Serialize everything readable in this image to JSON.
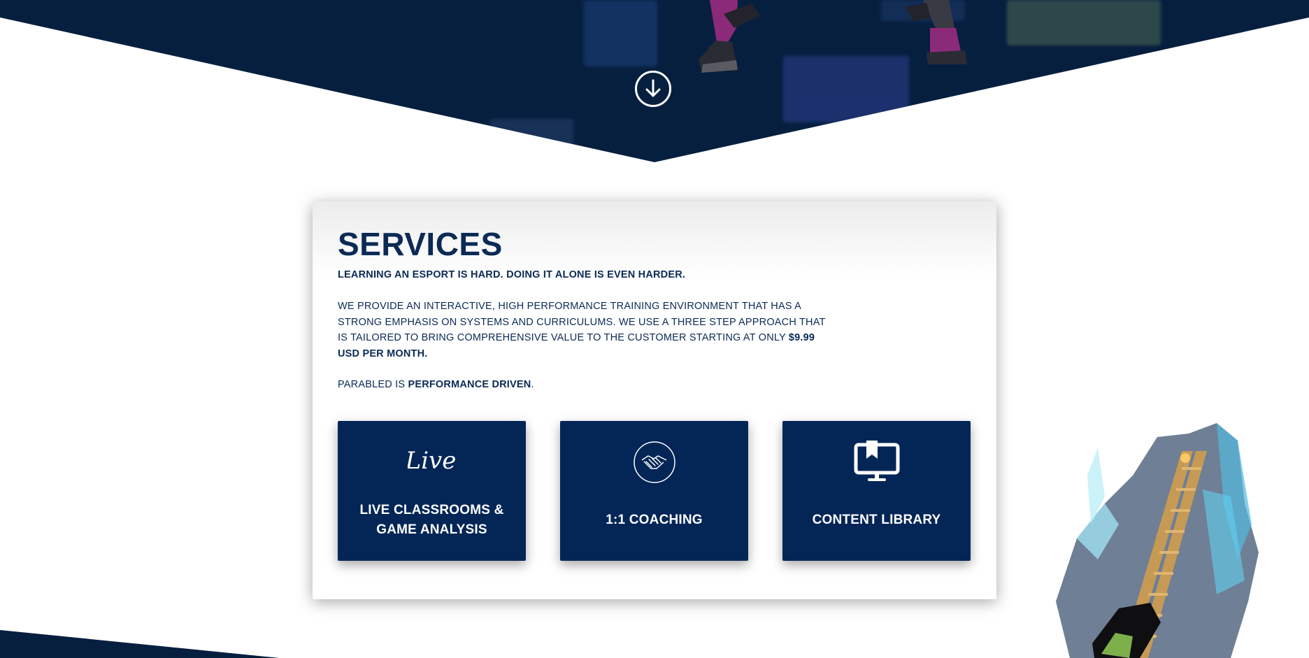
{
  "hero": {
    "scroll_icon": "arrow-down-circle-icon"
  },
  "services": {
    "title": "SERVICES",
    "tagline": "LEARNING AN ESPORT IS HARD. DOING IT ALONE IS EVEN HARDER.",
    "description_prefix": "WE PROVIDE AN INTERACTIVE, HIGH PERFORMANCE TRAINING ENVIRONMENT THAT HAS A STRONG EMPHASIS ON SYSTEMS AND CURRICULUMS. WE USE A THREE STEP APPROACH THAT IS TAILORED TO BRING COMPREHENSIVE VALUE TO THE CUSTOMER STARTING AT ONLY ",
    "description_price": "$9.99 USD PER MONTH.",
    "motto_prefix": "PARABLED IS ",
    "motto_emphasis": "PERFORMANCE DRIVEN",
    "motto_suffix": ".",
    "tiles": [
      {
        "label": "LIVE CLASSROOMS & GAME ANALYSIS",
        "icon": "live-script-icon",
        "icon_text": "Live"
      },
      {
        "label": "1:1 COACHING",
        "icon": "handshake-icon"
      },
      {
        "label": "CONTENT LIBRARY",
        "icon": "monitor-bookmark-icon"
      }
    ]
  },
  "colors": {
    "navy": "#071f3f",
    "tile_blue": "#032657",
    "heading_blue": "#0b2a55"
  }
}
